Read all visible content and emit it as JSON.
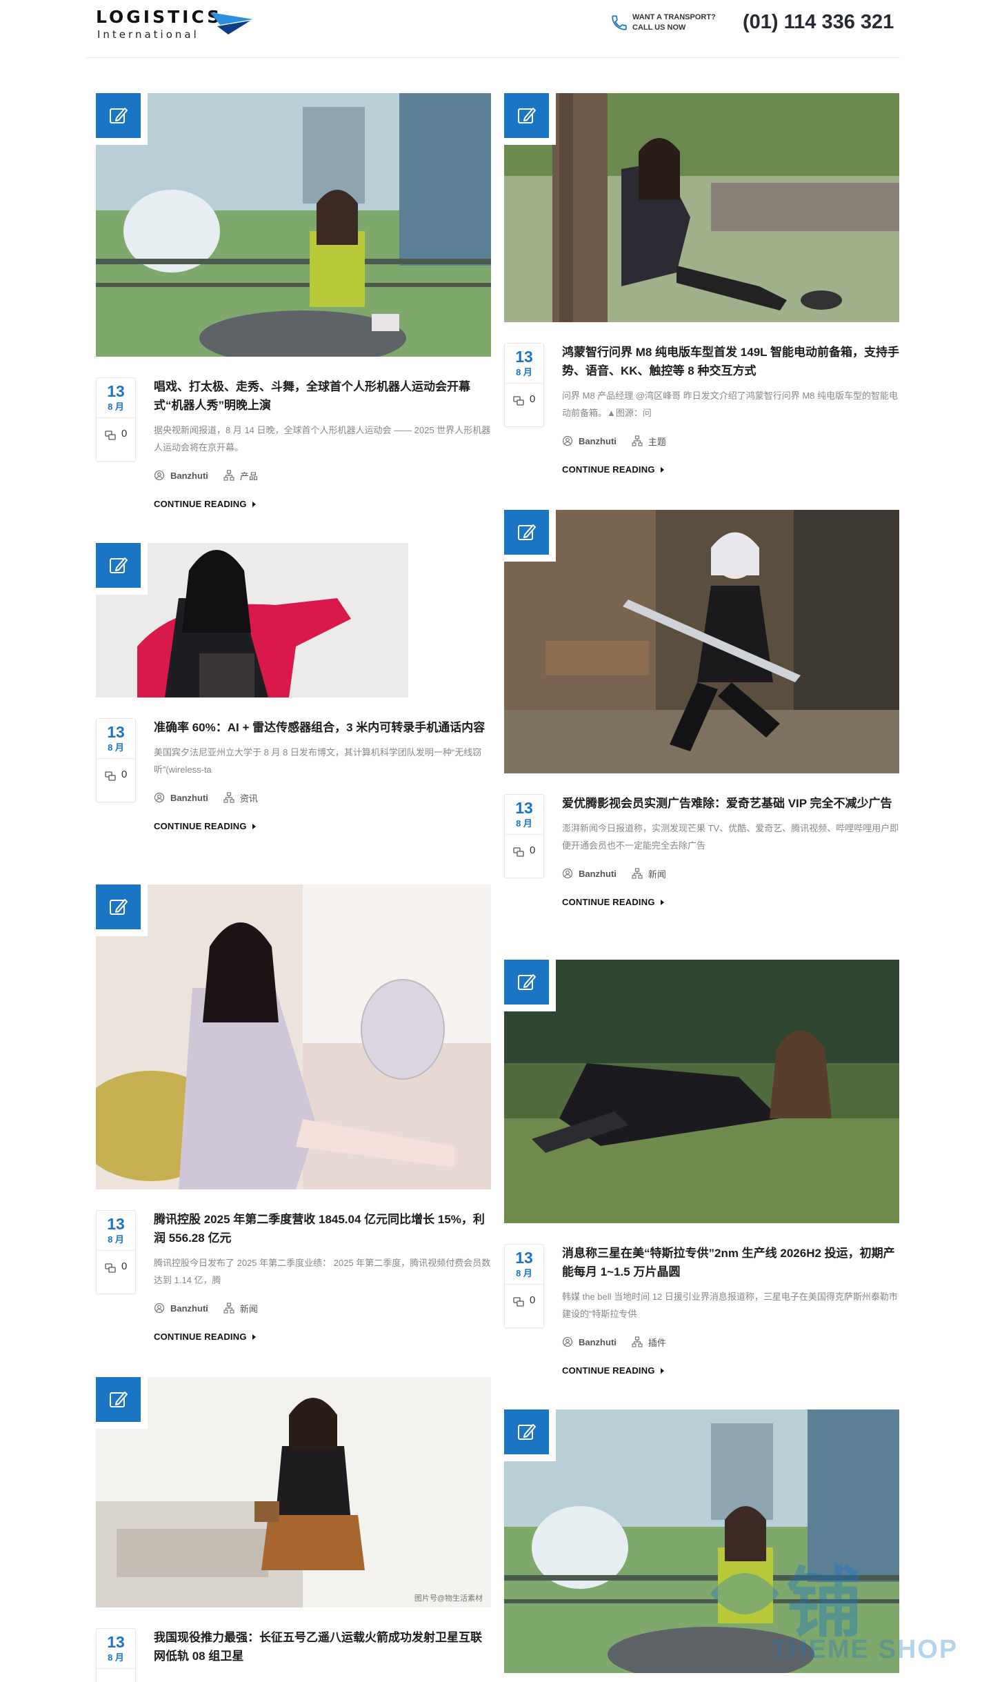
{
  "header": {
    "logo_main": "LOGISTICS",
    "logo_sub": "International",
    "call_label": "WANT A TRANSPORT?\nCALL US NOW",
    "phone": "(01) 114 336 321"
  },
  "labels": {
    "continue": "CONTINUE READING"
  },
  "colors": {
    "accent": "#1b75c5",
    "title": "#1d1d1d",
    "excerpt": "#888888"
  },
  "posts": [
    {
      "title": "唱戏、打太极、走秀、斗舞，全球首个人形机器人运动会开幕式“机器人秀”明晚上演",
      "excerpt": "据央视新闻报道，8 月 14 日晚，全球首个人形机器人运动会 —— 2025 世界人形机器人运动会将在京开幕。",
      "day": "13",
      "month": "8 月",
      "comments": "0",
      "author": "Banzhuti",
      "category": "产品"
    },
    {
      "title": "鸿蒙智行问界 M8 纯电版车型首发 149L 智能电动前备箱，支持手势、语音、KK、触控等 8 种交互方式",
      "excerpt": "问界 M8 产品经理 @湾区峰哥 昨日发文介绍了鸿蒙智行问界 M8 纯电版车型的智能电动前备箱。▲图源：问",
      "day": "13",
      "month": "8 月",
      "comments": "0",
      "author": "Banzhuti",
      "category": "主题"
    },
    {
      "title": "准确率 60%：AI + 雷达传感器组合，3 米内可转录手机通话内容",
      "excerpt": "美国宾夕法尼亚州立大学于 8 月 8 日发布博文，其计算机科学团队发明一种“无线窃听”(wireless-ta",
      "day": "13",
      "month": "8 月",
      "comments": "0",
      "author": "Banzhuti",
      "category": "资讯"
    },
    {
      "title": "爱优腾影视会员实测广告难除：爱奇艺基础 VIP 完全不减少广告",
      "excerpt": "澎湃新闻今日报道称，实测发现芒果 TV、优酷、爱奇艺、腾讯视频、哔哩哔哩用户即便开通会员也不一定能完全去除广告",
      "day": "13",
      "month": "8 月",
      "comments": "0",
      "author": "Banzhuti",
      "category": "新闻"
    },
    {
      "title": "腾讯控股 2025 年第二季度营收 1845.04 亿元同比增长 15%，利润 556.28 亿元",
      "excerpt": "腾讯控股今日发布了 2025 年第二季度业绩： 2025 年第二季度，腾讯视频付费会员数达到 1.14 亿，腾",
      "day": "13",
      "month": "8 月",
      "comments": "0",
      "author": "Banzhuti",
      "category": "新闻"
    },
    {
      "title": "消息称三星在美“特斯拉专供”2nm 生产线 2026H2 投运，初期产能每月 1~1.5 万片晶圆",
      "excerpt": "韩媒 the bell 当地时间 12 日援引业界消息报道称，三星电子在美国得克萨斯州泰勒市建设的“特斯拉专供",
      "day": "13",
      "month": "8 月",
      "comments": "0",
      "author": "Banzhuti",
      "category": "插件"
    },
    {
      "title": "我国现役推力最强：长征五号乙遥八运载火箭成功发射卫星互联网低轨 08 组卫星",
      "excerpt": "",
      "day": "13",
      "month": "8 月",
      "comments": "",
      "author": "",
      "category": ""
    }
  ],
  "watermark": {
    "text": "铺",
    "sub": "THEME SHOP",
    "image_caption": "图片号@物生活素材"
  }
}
